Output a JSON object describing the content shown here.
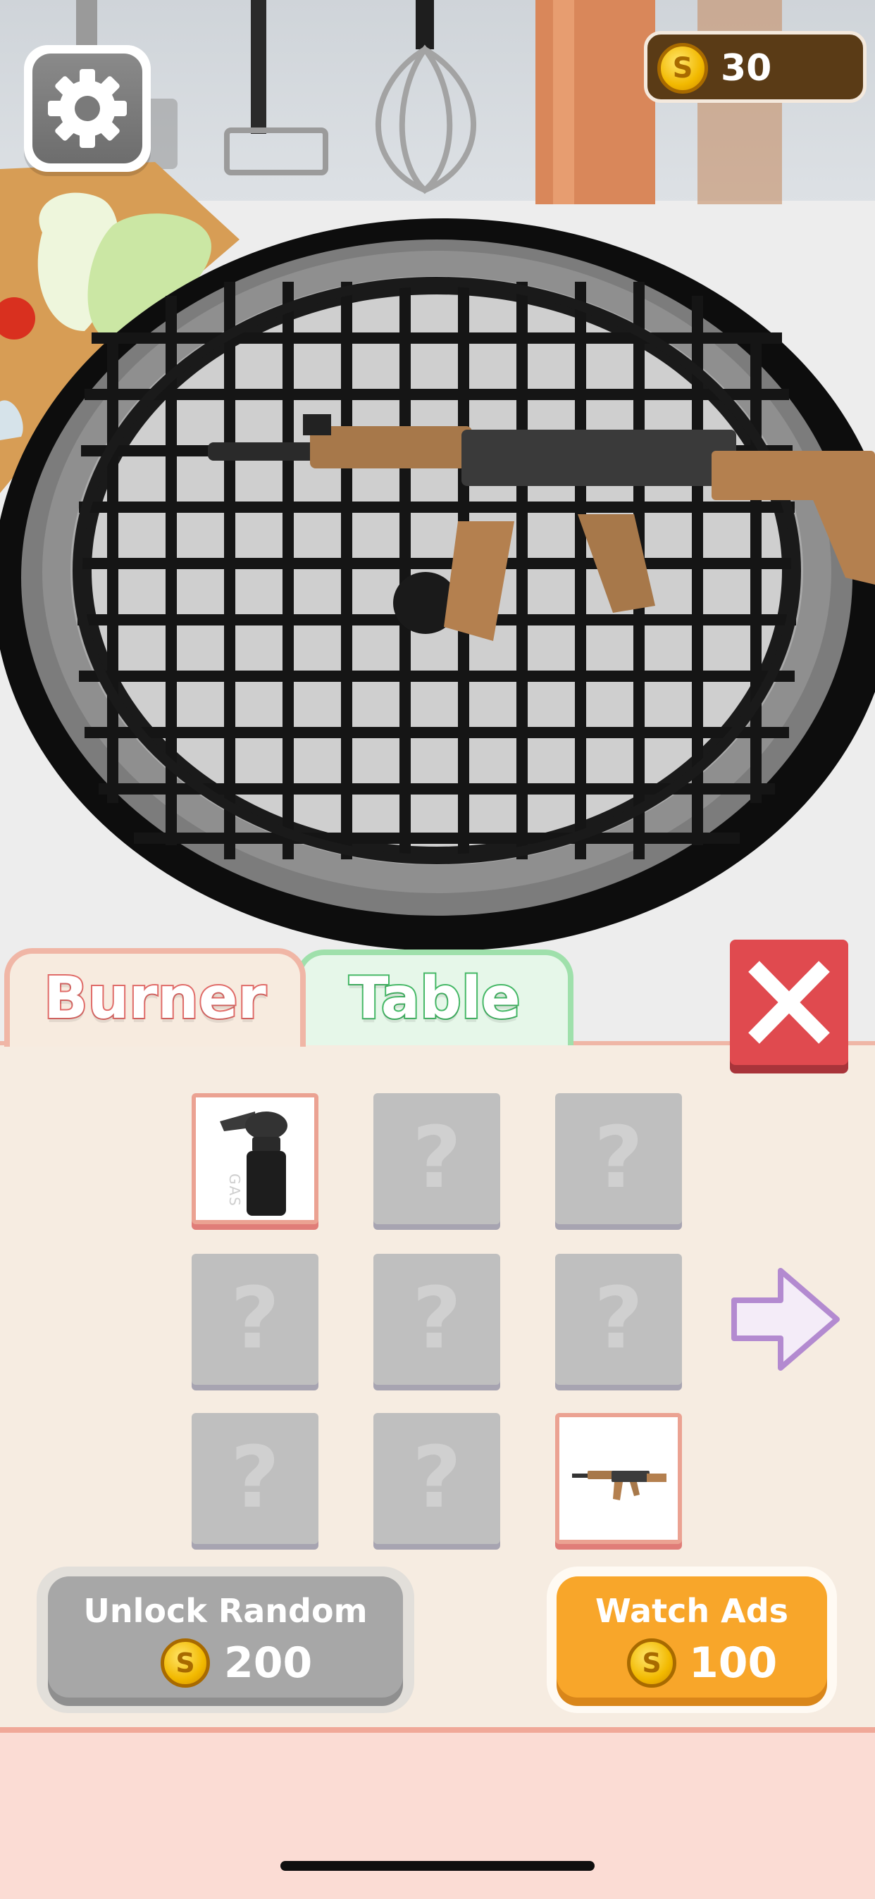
{
  "hud": {
    "coins": "30",
    "coin_symbol": "S"
  },
  "tabs": [
    {
      "label": "Burner",
      "active": true
    },
    {
      "label": "Table",
      "active": false
    }
  ],
  "grid": {
    "items": [
      {
        "state": "unlocked",
        "item": "gas-torch",
        "label": "GAS"
      },
      {
        "state": "locked",
        "label": "?"
      },
      {
        "state": "locked",
        "label": "?"
      },
      {
        "state": "locked",
        "label": "?"
      },
      {
        "state": "locked",
        "label": "?"
      },
      {
        "state": "locked",
        "label": "?"
      },
      {
        "state": "locked",
        "label": "?"
      },
      {
        "state": "locked",
        "label": "?"
      },
      {
        "state": "unlocked",
        "item": "rifle"
      }
    ]
  },
  "buttons": {
    "unlock_random": {
      "label": "Unlock Random",
      "price": "200"
    },
    "watch_ads": {
      "label": "Watch Ads",
      "price": "100"
    }
  },
  "colors": {
    "burner_accent": "#e06b68",
    "table_accent": "#45b866",
    "close": "#e04a4f",
    "watch_ads": "#f8a62a",
    "locked_tile": "#bfbfbf"
  }
}
